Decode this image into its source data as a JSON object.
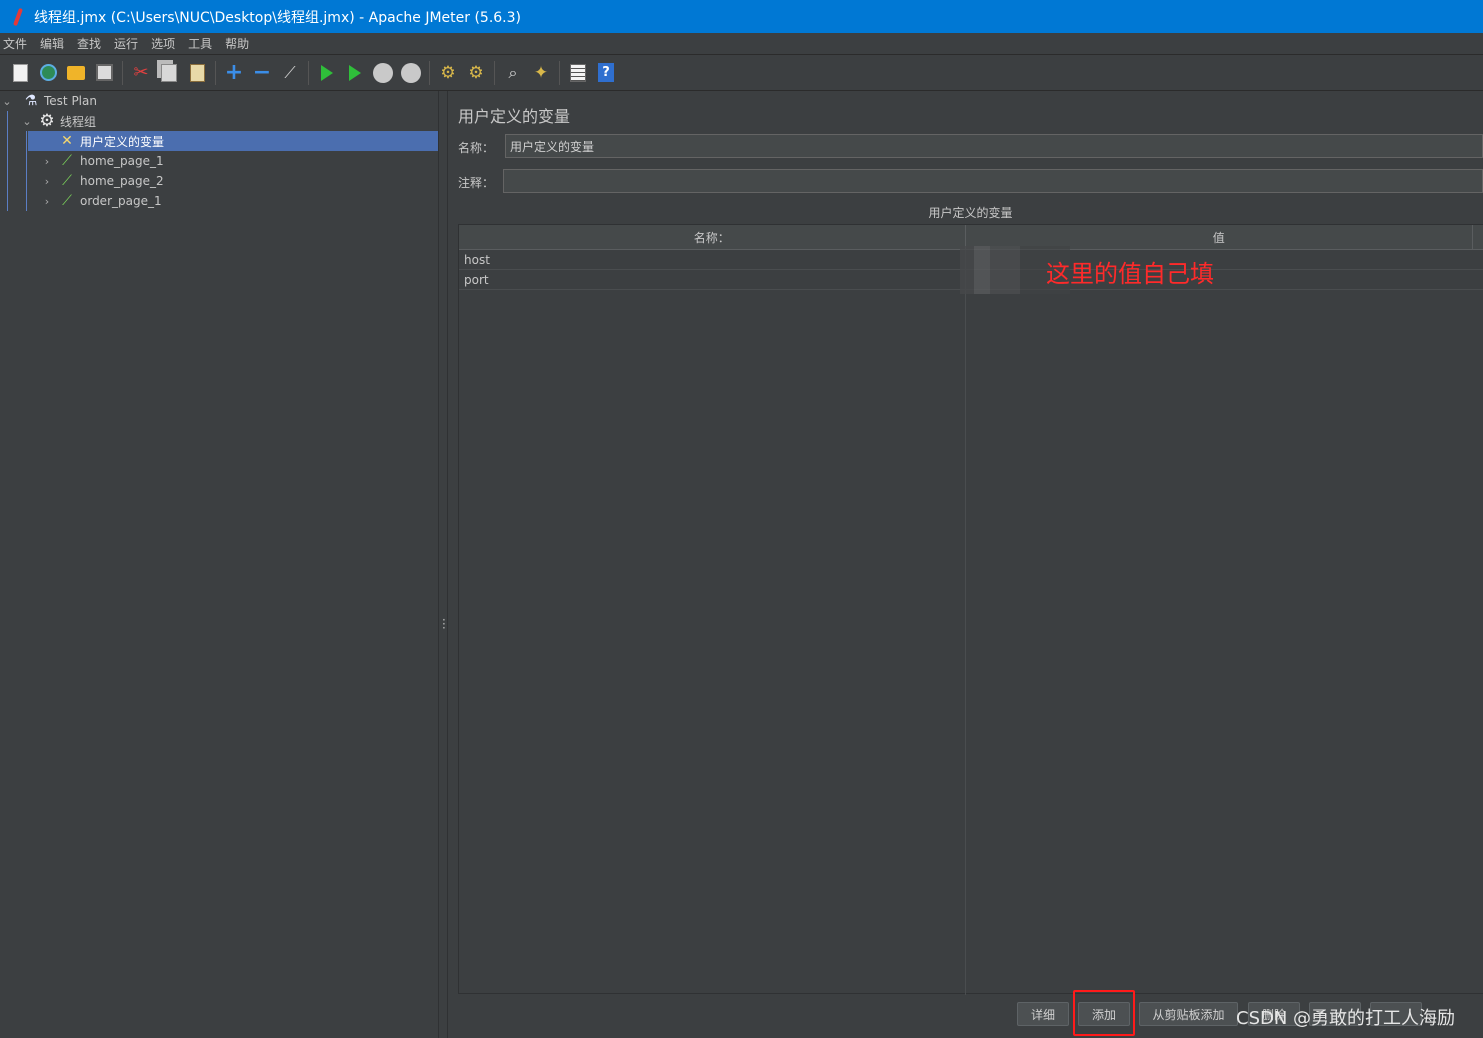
{
  "window": {
    "title": "线程组.jmx (C:\\Users\\NUC\\Desktop\\线程组.jmx) - Apache JMeter (5.6.3)"
  },
  "menu": [
    "文件",
    "编辑",
    "查找",
    "运行",
    "选项",
    "工具",
    "帮助"
  ],
  "toolbar": {
    "icons": [
      "new-icon",
      "templates-icon",
      "open-icon",
      "save-icon",
      "cut-icon",
      "copy-icon",
      "paste-icon",
      "expand-icon",
      "collapse-icon",
      "toggle-icon",
      "start-icon",
      "start-no-pause-icon",
      "stop-icon",
      "shutdown-icon",
      "clear-icon",
      "clear-all-icon",
      "search-icon",
      "reset-search-icon",
      "function-helper-icon",
      "help-icon"
    ]
  },
  "tree": {
    "nodes": [
      {
        "label": "Test Plan",
        "icon": "flask-icon",
        "expanded": true
      },
      {
        "label": "线程组",
        "icon": "gear-icon",
        "expanded": true
      },
      {
        "label": "用户定义的变量",
        "icon": "variables-icon",
        "selected": true
      },
      {
        "label": "home_page_1",
        "icon": "sampler-icon",
        "expanded": false
      },
      {
        "label": "home_page_2",
        "icon": "sampler-icon",
        "expanded": false
      },
      {
        "label": "order_page_1",
        "icon": "sampler-icon",
        "expanded": false
      }
    ]
  },
  "panel": {
    "title": "用户定义的变量",
    "name_label": "名称：",
    "name_value": "用户定义的变量",
    "comment_label": "注释：",
    "comment_value": "",
    "table_caption": "用户定义的变量",
    "columns": [
      "名称：",
      "值"
    ],
    "rows": [
      {
        "name": "host",
        "value": ""
      },
      {
        "name": "port",
        "value": ""
      }
    ],
    "annotation": "这里的值自己填"
  },
  "buttons": {
    "detail": "详细",
    "add": "添加",
    "add_from_clipboard": "从剪贴板添加",
    "delete": "删除",
    "up": "",
    "down": ""
  },
  "watermark": "CSDN @勇敢的打工人海励",
  "colors": {
    "titlebar": "#0078d4",
    "background": "#3c3f41",
    "selection": "#4b6eaf",
    "annotation": "#ff2a2a"
  }
}
